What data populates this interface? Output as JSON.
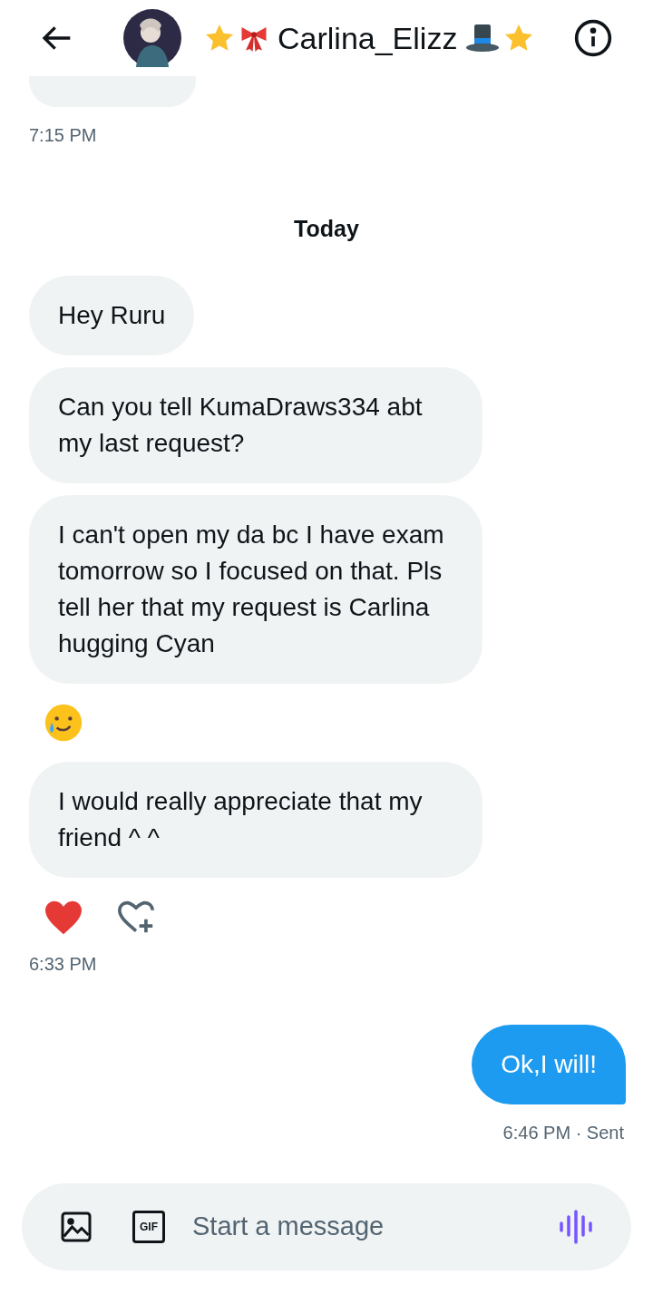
{
  "header": {
    "name": "Carlina_Elizz"
  },
  "earlier": {
    "time": "7:15 PM"
  },
  "day_separator": "Today",
  "messages": [
    {
      "kind": "text",
      "text": "Hey Ruru"
    },
    {
      "kind": "text",
      "text": "Can you tell KumaDraws334 abt my last request?"
    },
    {
      "kind": "text",
      "text": "I can't open my da bc I have exam tomorrow so I focused on that. Pls tell her that my request is Carlina hugging Cyan"
    },
    {
      "kind": "emoji"
    },
    {
      "kind": "text",
      "text": "I would really appreciate that my friend ^ ^"
    }
  ],
  "reactions": [
    {
      "kind": "heart"
    },
    {
      "kind": "add"
    }
  ],
  "received_time": "6:33 PM",
  "sent": {
    "text": "Ok,I will!",
    "time": "6:46 PM · Sent"
  },
  "composer": {
    "gif_label": "GIF",
    "placeholder": "Start a message"
  }
}
